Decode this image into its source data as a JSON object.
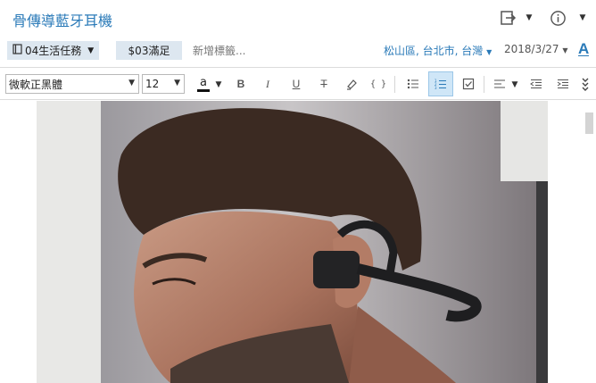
{
  "title": "骨傳導藍牙耳機",
  "meta": {
    "notebook": "04生活任務",
    "tag": "$03滿足",
    "tag_placeholder": "新增標籤...",
    "location": "松山區, 台北市, 台灣",
    "date": "2018/3/27",
    "font_icon": "A"
  },
  "toolbar": {
    "font": "微軟正黑體",
    "size": "12",
    "color_label": "a",
    "bold": "B",
    "italic": "I",
    "underline": "U",
    "strike": "T",
    "code": "{ }"
  },
  "colors": {
    "accent": "#2a7ab8",
    "chip": "#dde7f0",
    "active": "#cfe6f7"
  },
  "icons": [
    "share-icon",
    "info-icon",
    "highlighter-icon",
    "bullet-list-icon",
    "numbered-list-icon",
    "checkbox-icon",
    "align-icon",
    "outdent-icon",
    "indent-icon",
    "more-icon"
  ]
}
